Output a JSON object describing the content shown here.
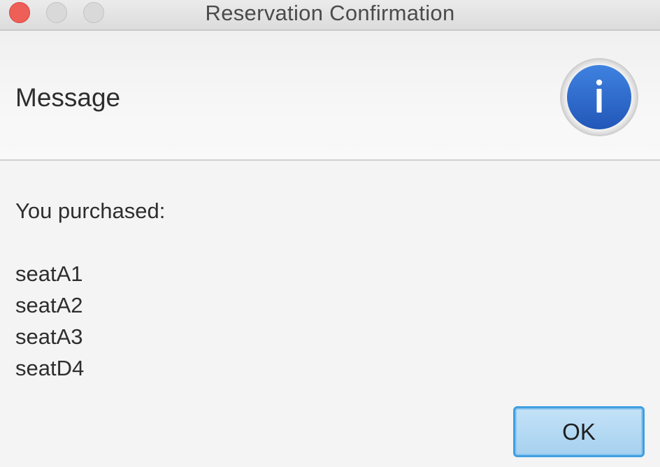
{
  "window": {
    "title": "Reservation Confirmation"
  },
  "header": {
    "text": "Message",
    "icon": "info-icon"
  },
  "content": {
    "intro": "You purchased:",
    "seats": [
      "seatA1",
      "seatA2",
      "seatA3",
      "seatD4"
    ]
  },
  "buttons": {
    "ok_label": "OK"
  },
  "colors": {
    "close": "#ee5f58",
    "info_blue": "#2f6fcf",
    "ok_button": "#a6d1ef"
  }
}
